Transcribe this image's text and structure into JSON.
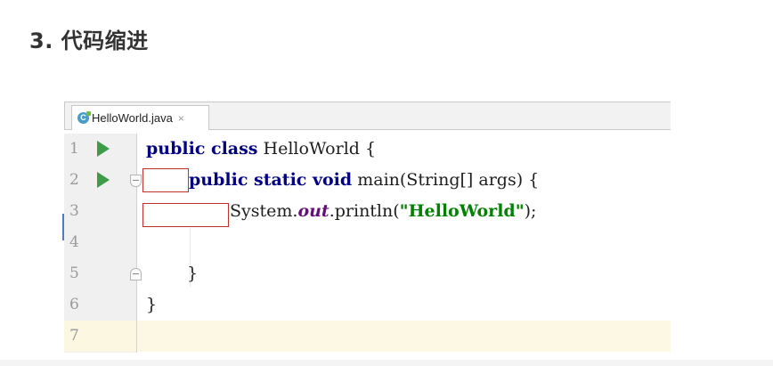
{
  "page": {
    "heading": "3. 代码缩进"
  },
  "editor": {
    "tab": {
      "icon_letter": "C",
      "filename": "HelloWorld.java",
      "close_glyph": "×"
    },
    "lines": [
      {
        "num": "1",
        "run": true
      },
      {
        "num": "2",
        "run": true
      },
      {
        "num": "3",
        "run": false
      },
      {
        "num": "4",
        "run": false
      },
      {
        "num": "5",
        "run": false
      },
      {
        "num": "6",
        "run": false
      },
      {
        "num": "7",
        "run": false
      }
    ],
    "code": {
      "l1_kw": "public class",
      "l1_rest": " HelloWorld {",
      "l2_kw": "public static void",
      "l2_rest": " main(String[] args) {",
      "l3_a": "System.",
      "l3_field": "out",
      "l3_b": ".println(",
      "l3_str": "\"HelloWorld\"",
      "l3_c": ");",
      "l5": "}",
      "l6": "}"
    }
  },
  "colors": {
    "keyword": "#000080",
    "string": "#008000",
    "field": "#660e7a",
    "run_icon": "#3e9b4a",
    "indent_highlight": "#c0312b",
    "current_line": "#fcf8e3"
  },
  "icons": [
    "java-class-icon",
    "close-icon",
    "run-icon",
    "fold-icon"
  ]
}
